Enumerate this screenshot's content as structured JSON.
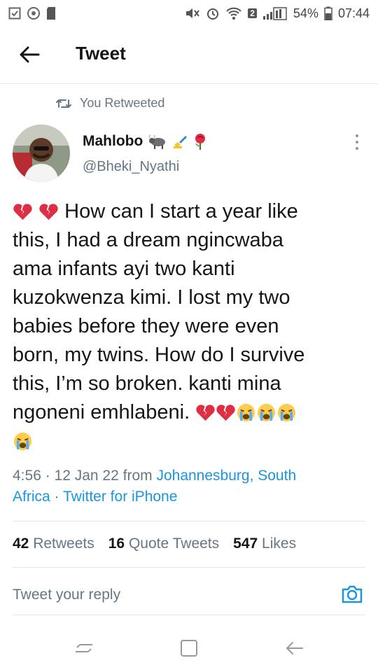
{
  "status_bar": {
    "battery": "54%",
    "time": "07:44",
    "sim_badge": "2",
    "icons": [
      "checkbox-icon",
      "instagram-icon",
      "sd-card-icon",
      "mute-icon",
      "alarm-icon",
      "wifi-icon",
      "signal-icon",
      "battery-icon"
    ]
  },
  "header": {
    "title": "Tweet",
    "back_icon": "arrow-left-icon"
  },
  "retweet": {
    "label": "You Retweeted",
    "icon": "retweet-icon"
  },
  "author": {
    "name": "Mahlobo",
    "name_emojis": [
      "ox-emoji",
      "writing-hand-emoji",
      "rose-emoji"
    ],
    "handle": "@Bheki_Nyathi"
  },
  "tweet": {
    "line1": "How can I start a year like",
    "line2": "this,  I had a dream ngincwaba",
    "line3": "ama infants ayi two kanti",
    "line4": "kuzokwenza kimi. I lost my two",
    "line5": "babies before they were even",
    "line6": "born, my twins. How do I survive",
    "line7": "this, I’m so broken. kanti mina",
    "line8": "ngoneni emhlabeni.",
    "leading_emojis": [
      "broken-heart-emoji",
      "broken-heart-emoji"
    ],
    "trailing_emojis": [
      "broken-heart-emoji",
      "broken-heart-emoji",
      "crying-face-emoji",
      "crying-face-emoji",
      "crying-face-emoji",
      "crying-face-emoji"
    ]
  },
  "meta": {
    "time_date": "4:56 · 12 Jan 22 from",
    "location_part1": "Johannesburg, South",
    "location_part2": "Africa",
    "separator": "·",
    "client": "Twitter for iPhone"
  },
  "stats": {
    "retweets_count": "42",
    "retweets_label": "Retweets",
    "quotes_count": "16",
    "quotes_label": "Quote Tweets",
    "likes_count": "547",
    "likes_label": "Likes"
  },
  "reply": {
    "placeholder": "Tweet your reply",
    "camera_icon": "camera-icon"
  },
  "nav_bar": {
    "icons": [
      "recents-icon",
      "home-icon",
      "back-icon"
    ]
  },
  "colors": {
    "link": "#1b95e0",
    "secondary_text": "#657786",
    "primary_text": "#14171a",
    "divider": "#e1e8ed",
    "broken_heart": "#dd2e44",
    "crying_face": "#ffcc4d"
  }
}
